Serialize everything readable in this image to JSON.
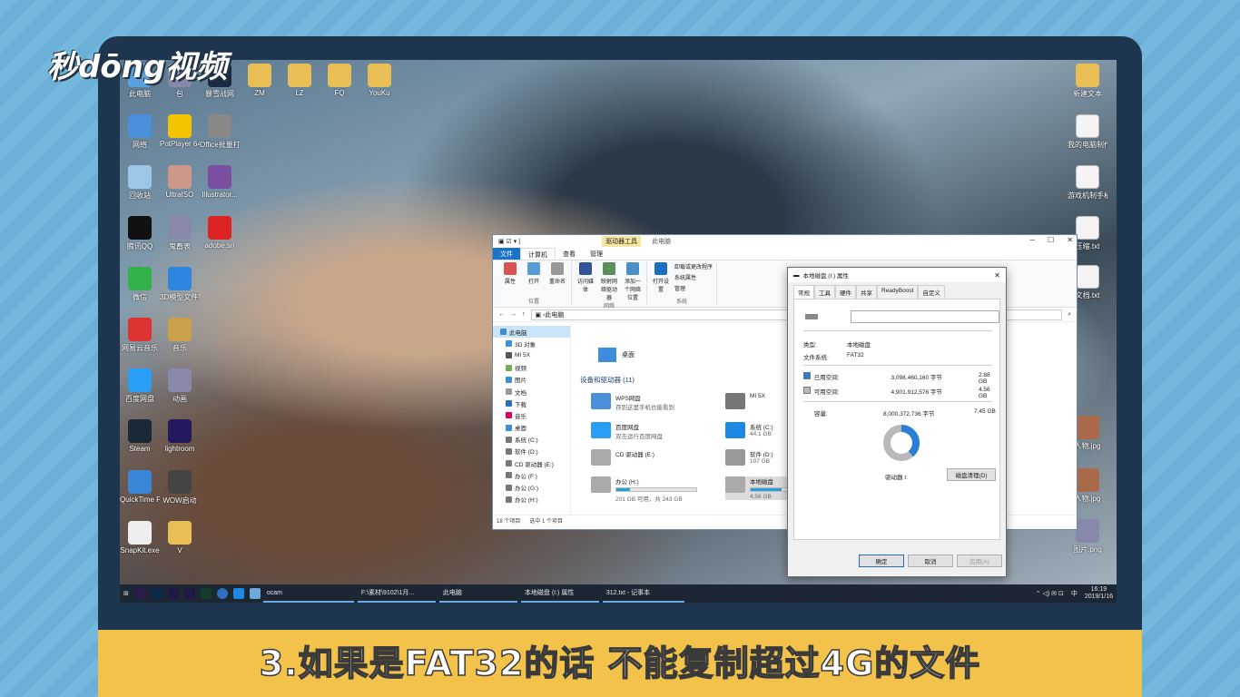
{
  "overlay": {
    "logo": "秒dōng视频",
    "caption": "3.如果是FAT32的话 不能复制超过4G的文件"
  },
  "desktop_icons_left": [
    {
      "label": "此电脑",
      "icon": "computer-icon"
    },
    {
      "label": "包",
      "icon": "app-icon"
    },
    {
      "label": "暴雪战网",
      "icon": "battlenet-icon"
    },
    {
      "label": "ZM",
      "icon": "folder-icon"
    },
    {
      "label": "LZ",
      "icon": "folder-icon"
    },
    {
      "label": "FQ",
      "icon": "folder-icon"
    },
    {
      "label": "YouKu",
      "icon": "folder-icon"
    },
    {
      "label": "网络",
      "icon": "network-icon"
    },
    {
      "label": "PotPlayer 64 bit",
      "icon": "potplayer-icon"
    },
    {
      "label": "Office批量打印精灵.exe",
      "icon": "printer-icon"
    },
    {
      "label": "回收站",
      "icon": "recycle-bin-icon"
    },
    {
      "label": "UltraISO",
      "icon": "disc-icon"
    },
    {
      "label": "Illustrator...",
      "icon": "winrar-icon"
    },
    {
      "label": "腾讯QQ",
      "icon": "qq-icon"
    },
    {
      "label": "鬼畜表",
      "icon": "app-icon"
    },
    {
      "label": "adobe.sn",
      "icon": "adobe-icon"
    },
    {
      "label": "微信",
      "icon": "wechat-icon"
    },
    {
      "label": "3D模型文件转换器.exe",
      "icon": "folder-blue-icon"
    },
    {
      "label": "网易云音乐",
      "icon": "netease-music-icon"
    },
    {
      "label": "音乐",
      "icon": "music-folder-icon"
    },
    {
      "label": "百度网盘",
      "icon": "baidu-netdisk-icon"
    },
    {
      "label": "动画",
      "icon": "app-icon"
    },
    {
      "label": "Steam",
      "icon": "steam-icon"
    },
    {
      "label": "lightroom",
      "icon": "after-effects-icon"
    },
    {
      "label": "QuickTime Player",
      "icon": "quicktime-icon"
    },
    {
      "label": "WOW启动",
      "icon": "wow-icon"
    },
    {
      "label": "SnapKit.exe",
      "icon": "document-icon"
    },
    {
      "label": "V",
      "icon": "folder-icon"
    }
  ],
  "desktop_icons_right": [
    {
      "label": "新建文本",
      "icon": "folder-icon"
    },
    {
      "label": "我的电脑制作更改值.txt",
      "icon": "text-file-icon"
    },
    {
      "label": "游戏机制手柄.txt",
      "icon": "text-file-icon"
    },
    {
      "label": "压缩.txt",
      "icon": "text-file-icon"
    },
    {
      "label": "文档.txt",
      "icon": "text-file-icon"
    },
    {
      "label": "人物.jpg",
      "icon": "image-icon"
    },
    {
      "label": "人物.jpg",
      "icon": "image-icon"
    },
    {
      "label": "图片.png",
      "icon": "app-icon"
    }
  ],
  "explorer": {
    "context_tab": "驱动器工具",
    "title": "此电脑",
    "window_controls": [
      "─",
      "☐",
      "✕"
    ],
    "tabs": [
      "文件",
      "计算机",
      "查看",
      "管理"
    ],
    "ribbon": {
      "location_group": {
        "label": "位置",
        "buttons": [
          "属性",
          "打开",
          "重命名"
        ]
      },
      "network_group": {
        "label": "网络",
        "buttons": [
          "访问媒体",
          "映射网络驱动器",
          "添加一个网络位置"
        ]
      },
      "system_group": {
        "label": "系统",
        "button": "打开设置",
        "list": [
          "卸载或更改程序",
          "系统属性",
          "管理"
        ]
      }
    },
    "address": "此电脑",
    "nav": [
      "此电脑",
      "3D 对象",
      "MI 5X",
      "视频",
      "图片",
      "文档",
      "下载",
      "音乐",
      "桌面",
      "系统 (C:)",
      "软件 (D:)",
      "CD 驱动器 (E:)",
      "办公 (F:)",
      "办公 (G:)",
      "办公 (H:)"
    ],
    "desktop_label": "桌面",
    "section_header": "设备和驱动器 (11)",
    "drives": [
      {
        "name": "WPS网盘",
        "sub": "存到这里手机也能看到"
      },
      {
        "name": "MI 5X",
        "sub": ""
      },
      {
        "name": "百度网盘",
        "sub": "双击运行百度网盘"
      },
      {
        "name": "系统 (C:)",
        "sub": "44.1 GB"
      },
      {
        "name": "CD 驱动器 (E:)",
        "sub": ""
      },
      {
        "name": "软件 (D:)",
        "sub": "107 GB"
      },
      {
        "name": "办公 (H:)",
        "sub": "201 GB 可用，共 243 GB",
        "fill": 0.17
      },
      {
        "name": "本地磁盘",
        "sub": "4.56 GB",
        "fill": 0.39
      }
    ],
    "status_count": "18 个项目",
    "status_selected": "选中 1 个项目"
  },
  "properties": {
    "title": "本地磁盘 (I:) 属性",
    "tabs": [
      "常规",
      "工具",
      "硬件",
      "共享",
      "ReadyBoost",
      "自定义"
    ],
    "name_value": "",
    "type_label": "类型:",
    "type_value": "本地磁盘",
    "fs_label": "文件系统:",
    "fs_value": "FAT32",
    "used_label": "已用空间:",
    "used_bytes": "3,098,460,160 字节",
    "used_gb": "2.88 GB",
    "free_label": "可用空间:",
    "free_bytes": "4,901,912,576 字节",
    "free_gb": "4.56 GB",
    "capacity_label": "容量:",
    "capacity_bytes": "8,000,372,736 字节",
    "capacity_gb": "7.45 GB",
    "drive_label": "驱动器 I:",
    "cleanup_button": "磁盘清理(D)",
    "ok": "确定",
    "cancel": "取消",
    "apply": "应用(A)",
    "used_fraction": 0.387,
    "colors": {
      "used": "#2a7fd4",
      "free": "#b9b9b9"
    }
  },
  "taskbar": {
    "items": [
      {
        "label": "ocam"
      },
      {
        "label": "F:\\素材\\9102\\1月..."
      },
      {
        "label": "此电脑"
      },
      {
        "label": "本地磁盘 (I:) 属性"
      },
      {
        "label": "312.txt - 记事本"
      }
    ],
    "tray_lang": "中",
    "time": "16:19",
    "date": "2019/1/16"
  }
}
